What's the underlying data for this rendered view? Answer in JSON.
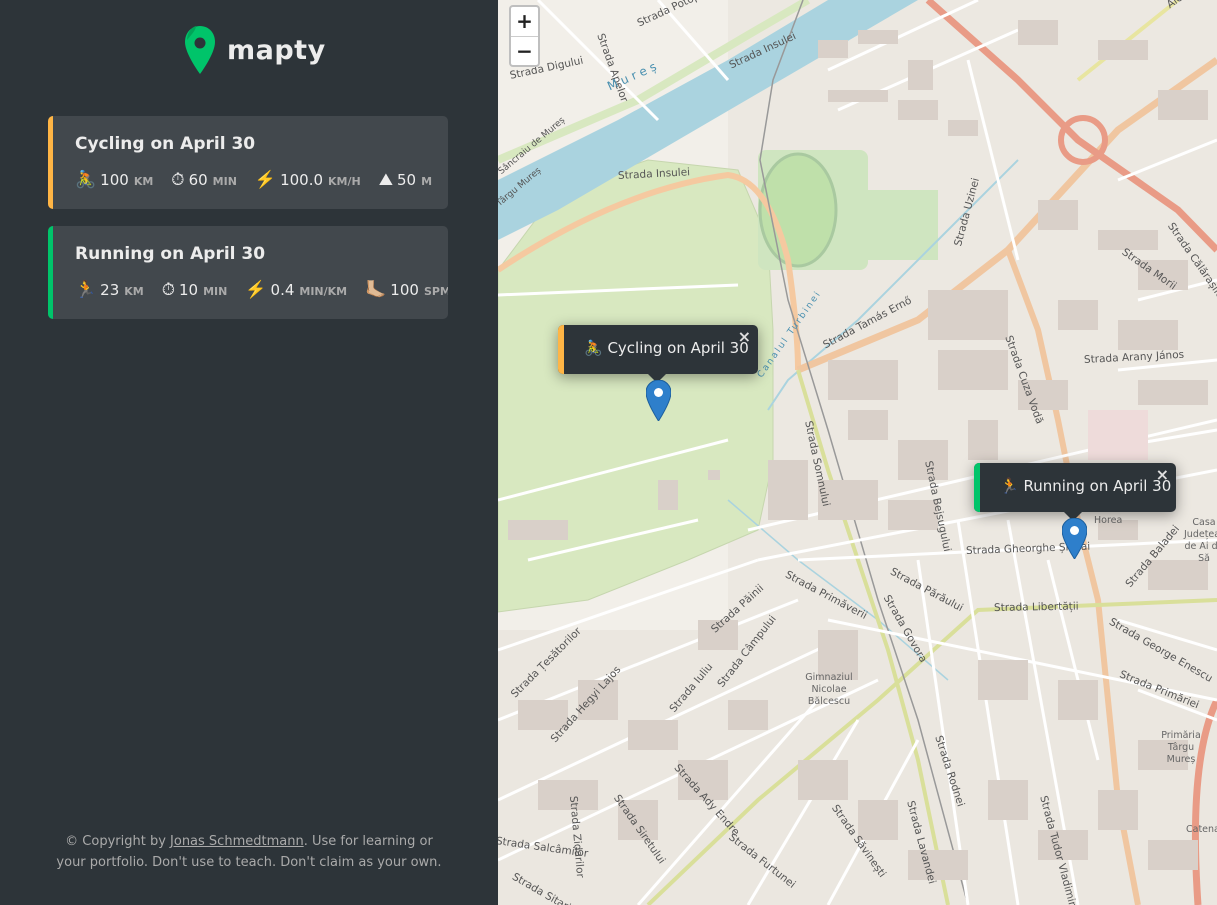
{
  "brand": {
    "name": "mapty",
    "accent": "#00c46a"
  },
  "workouts": [
    {
      "title": "Cycling on April 30",
      "accent": "#ffb545",
      "details": [
        {
          "icon": "🚴",
          "value": "100",
          "unit": "KM"
        },
        {
          "icon": "⏱",
          "value": "60",
          "unit": "MIN"
        },
        {
          "icon": "⚡️",
          "value": "100.0",
          "unit": "KM/H"
        },
        {
          "icon": "⛰",
          "value": "50",
          "unit": "M"
        }
      ]
    },
    {
      "title": "Running on April 30",
      "accent": "#00c46a",
      "details": [
        {
          "icon": "🏃",
          "value": "23",
          "unit": "KM"
        },
        {
          "icon": "⏱",
          "value": "10",
          "unit": "MIN"
        },
        {
          "icon": "⚡️",
          "value": "0.4",
          "unit": "MIN/KM"
        },
        {
          "icon": "🦶🏼",
          "value": "100",
          "unit": "SPM"
        }
      ]
    }
  ],
  "copyright": {
    "prefix": "© Copyright by ",
    "link": "Jonas Schmedtmann",
    "suffix": ". Use for learning or your portfolio. Don't use to teach. Don't claim as your own."
  },
  "map": {
    "zoom_in": "+",
    "zoom_out": "−",
    "popups": [
      {
        "text": "🚴 Cycling on April 30",
        "close": "×",
        "accent": "#ffb545"
      },
      {
        "text": "🏃 Running on April 30",
        "close": "×",
        "accent": "#00c46a"
      }
    ],
    "streets": [
      "Strada Digului",
      "Strada Apelor",
      "Strada Potopului",
      "Strada Insulei",
      "Strada Insulei",
      "Mureș",
      "Sâncraiu de Mureș",
      "Târgu Mureș",
      "Canalul Turbinei",
      "Strada Tamás Ernő",
      "Strada Uzinei",
      "Strada Morii",
      "Strada Călărașilor",
      "Strada Arany János",
      "Strada Cuza Vodă",
      "Strada Somnului",
      "Strada Bejsugului",
      "Strada Gheorghe Șincai",
      "Strada Baladei",
      "Strada Părăului",
      "Strada Govora",
      "Strada Libertății",
      "Strada George Enescu",
      "Strada Primăverii",
      "Strada Păinii",
      "Strada Câmpului",
      "Strada Iuliu",
      "Strada Ady Endre",
      "Strada Hegyi Lajos",
      "Strada Țesătorilor",
      "Strada Zidarilor",
      "Strada Siretului",
      "Strada Furtunei",
      "Strada Săvinești",
      "Strada Lavandei",
      "Strada Rodnei",
      "Strada Tudor Vladimirescu",
      "Strada Salcâmilor",
      "Strada Sitarilor",
      "Strada Primăriei",
      "Aleea"
    ],
    "pois": [
      "Horea",
      "Casa Județeană de Ai de Să",
      "Gimnaziul Nicolae Bălcescu",
      "Primăria Târgu Mureș",
      "Catena"
    ]
  }
}
